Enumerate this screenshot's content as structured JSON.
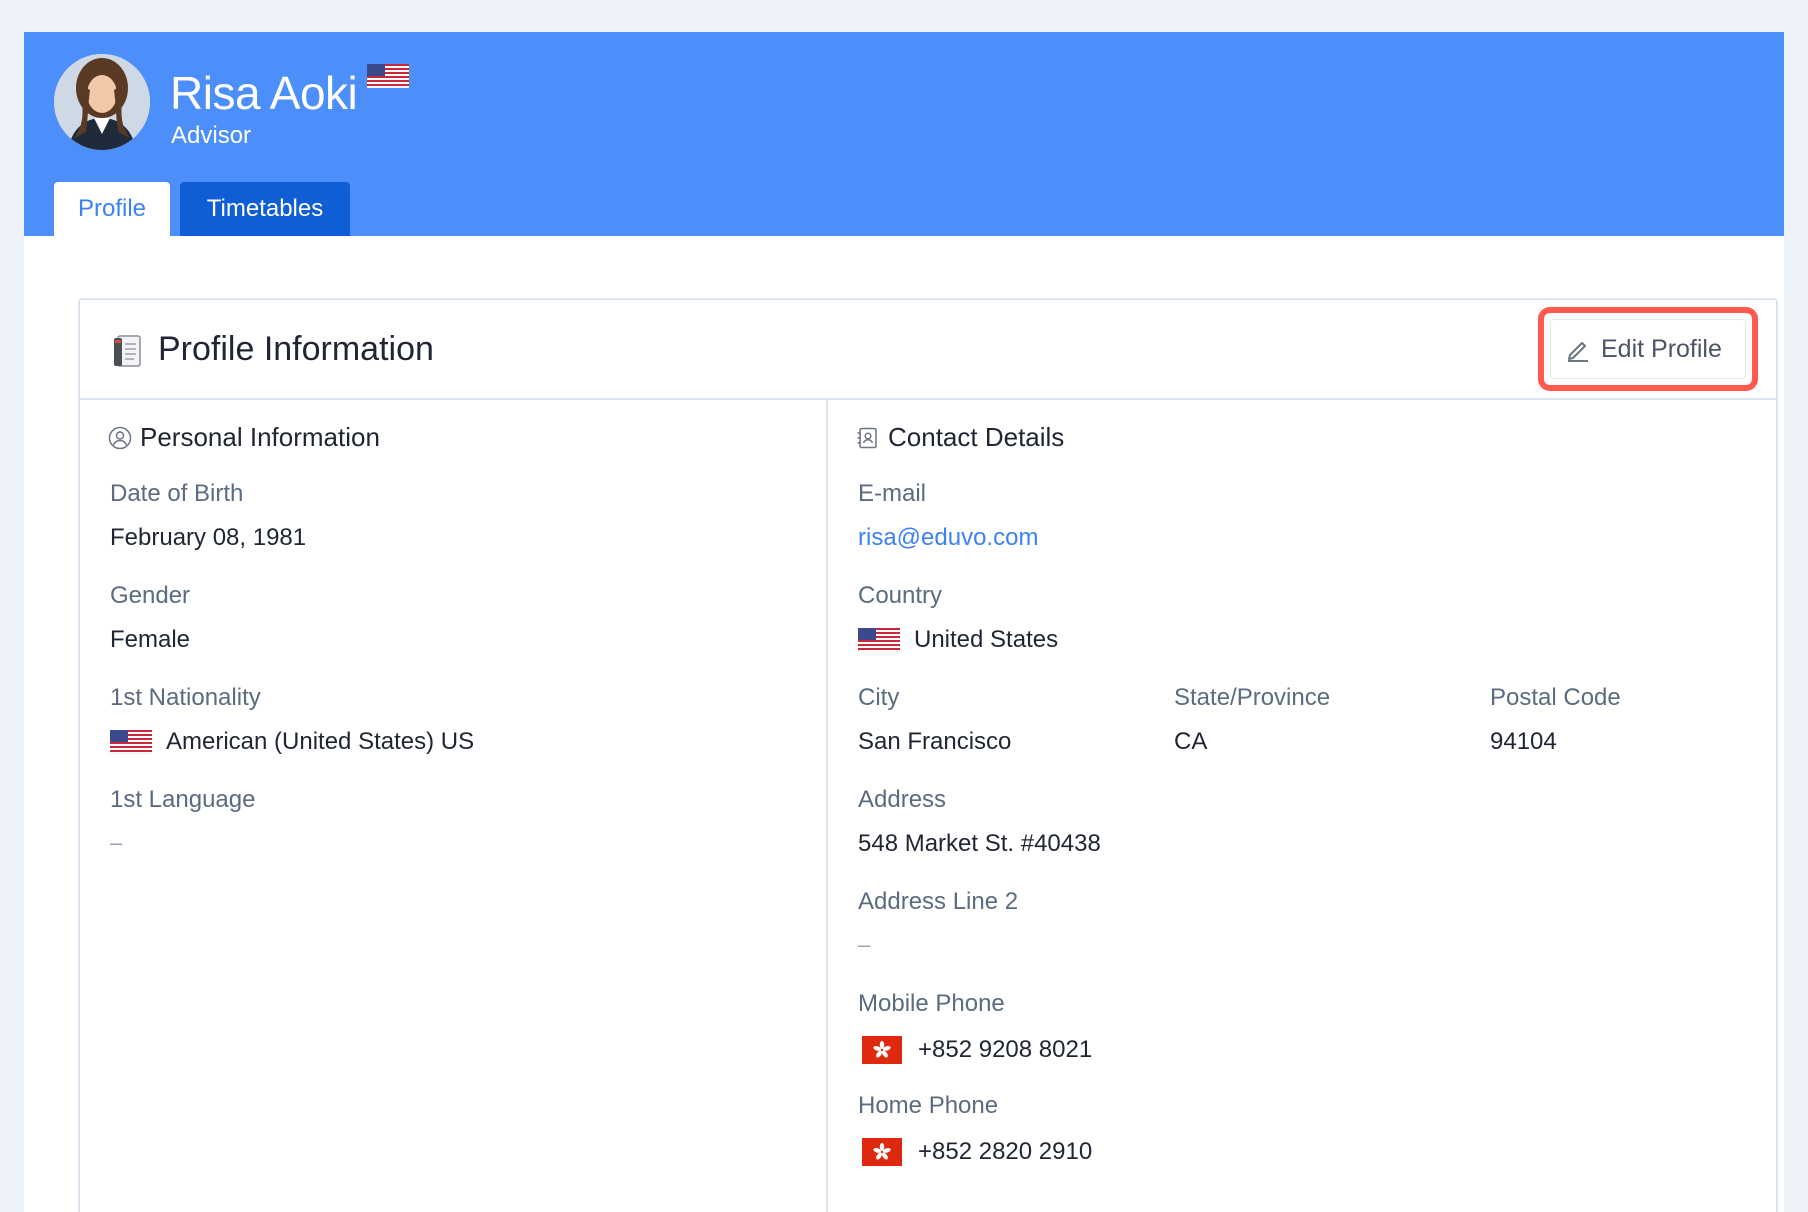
{
  "user": {
    "name": "Risa Aoki",
    "role": "Advisor",
    "flag_icon": "us-flag-icon"
  },
  "tabs": [
    {
      "label": "Profile",
      "active": true
    },
    {
      "label": "Timetables",
      "active": false
    }
  ],
  "card": {
    "title": "Profile Information",
    "title_icon": "notebook-icon",
    "edit_button": "Edit Profile"
  },
  "personal": {
    "title": "Personal Information",
    "dob_label": "Date of Birth",
    "dob": "February 08, 1981",
    "gender_label": "Gender",
    "gender": "Female",
    "nationality_label": "1st Nationality",
    "nationality": "American (United States) US",
    "language_label": "1st Language",
    "language": "–"
  },
  "contact": {
    "title": "Contact Details",
    "email_label": "E-mail",
    "email": "risa@eduvo.com",
    "country_label": "Country",
    "country": "United States",
    "city_label": "City",
    "city": "San Francisco",
    "state_label": "State/Province",
    "state": "CA",
    "postal_label": "Postal Code",
    "postal": "94104",
    "address_label": "Address",
    "address": "548 Market St. #40438",
    "address2_label": "Address Line 2",
    "address2": "–",
    "mobile_label": "Mobile Phone",
    "mobile": "+852 9208 8021",
    "home_label": "Home Phone",
    "home": "+852 2820 2910"
  },
  "colors": {
    "banner": "#4c8ffb",
    "active_tab_text": "#3b82f6",
    "inactive_tab_bg": "#0f5ed6",
    "highlight": "#ff5a4d",
    "link": "#3b82f6"
  }
}
